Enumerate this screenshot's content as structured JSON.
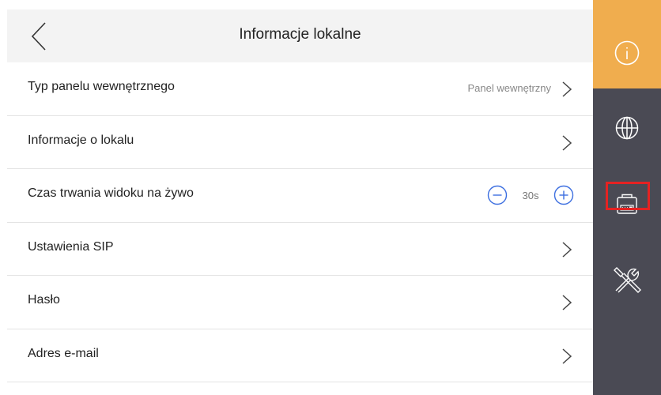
{
  "header": {
    "title": "Informacje lokalne"
  },
  "rows": [
    {
      "label": "Typ panelu wewnętrznego",
      "value": "Panel wewnętrzny"
    },
    {
      "label": "Informacje o lokalu"
    },
    {
      "label": "Czas trwania widoku na żywo",
      "value": "30s"
    },
    {
      "label": "Ustawienia SIP"
    },
    {
      "label": "Hasło"
    },
    {
      "label": "Adres e-mail"
    }
  ],
  "sidebar": {
    "items": [
      {
        "icon": "info-icon",
        "active": true
      },
      {
        "icon": "globe-icon",
        "active": false
      },
      {
        "icon": "indoor-panel-icon",
        "active": false,
        "highlighted": true
      },
      {
        "icon": "tools-icon",
        "active": false
      }
    ]
  },
  "colors": {
    "accent": "#f0ad4e",
    "sidebar": "#4a4a54",
    "header_bg": "#f3f3f3",
    "stepper": "#3d6fe0",
    "highlight": "#e52222"
  }
}
